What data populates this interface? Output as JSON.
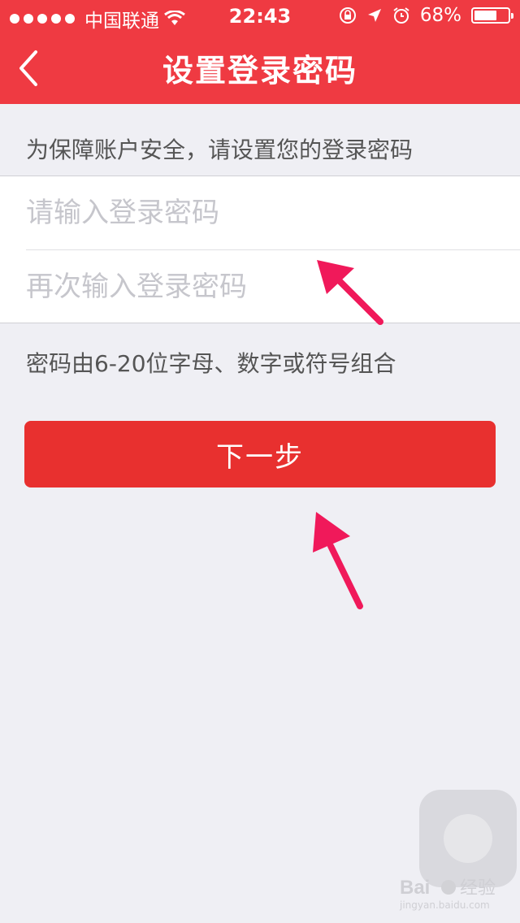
{
  "status_bar": {
    "carrier": "中国联通",
    "time": "22:43",
    "battery": "68%",
    "battery_level": 0.68,
    "icons": [
      "signal-dots",
      "wifi-icon",
      "rotation-lock-icon",
      "location-icon",
      "alarm-icon",
      "battery-icon"
    ]
  },
  "nav": {
    "title": "设置登录密码",
    "back_icon": "chevron-left-icon"
  },
  "colors": {
    "header": "#ef3a42",
    "button": "#e8302f",
    "background": "#efeff4",
    "annotation_arrow": "#f0195a"
  },
  "form": {
    "hint": "为保障账户安全，请设置您的登录密码",
    "password_placeholder": "请输入登录密码",
    "confirm_placeholder": "再次输入登录密码",
    "password_value": "",
    "confirm_value": "",
    "rule": "密码由6-20位字母、数字或符号组合",
    "next_label": "下一步"
  },
  "watermark": {
    "brand": "Bai经验",
    "url": "jingyan.baidu.com"
  }
}
